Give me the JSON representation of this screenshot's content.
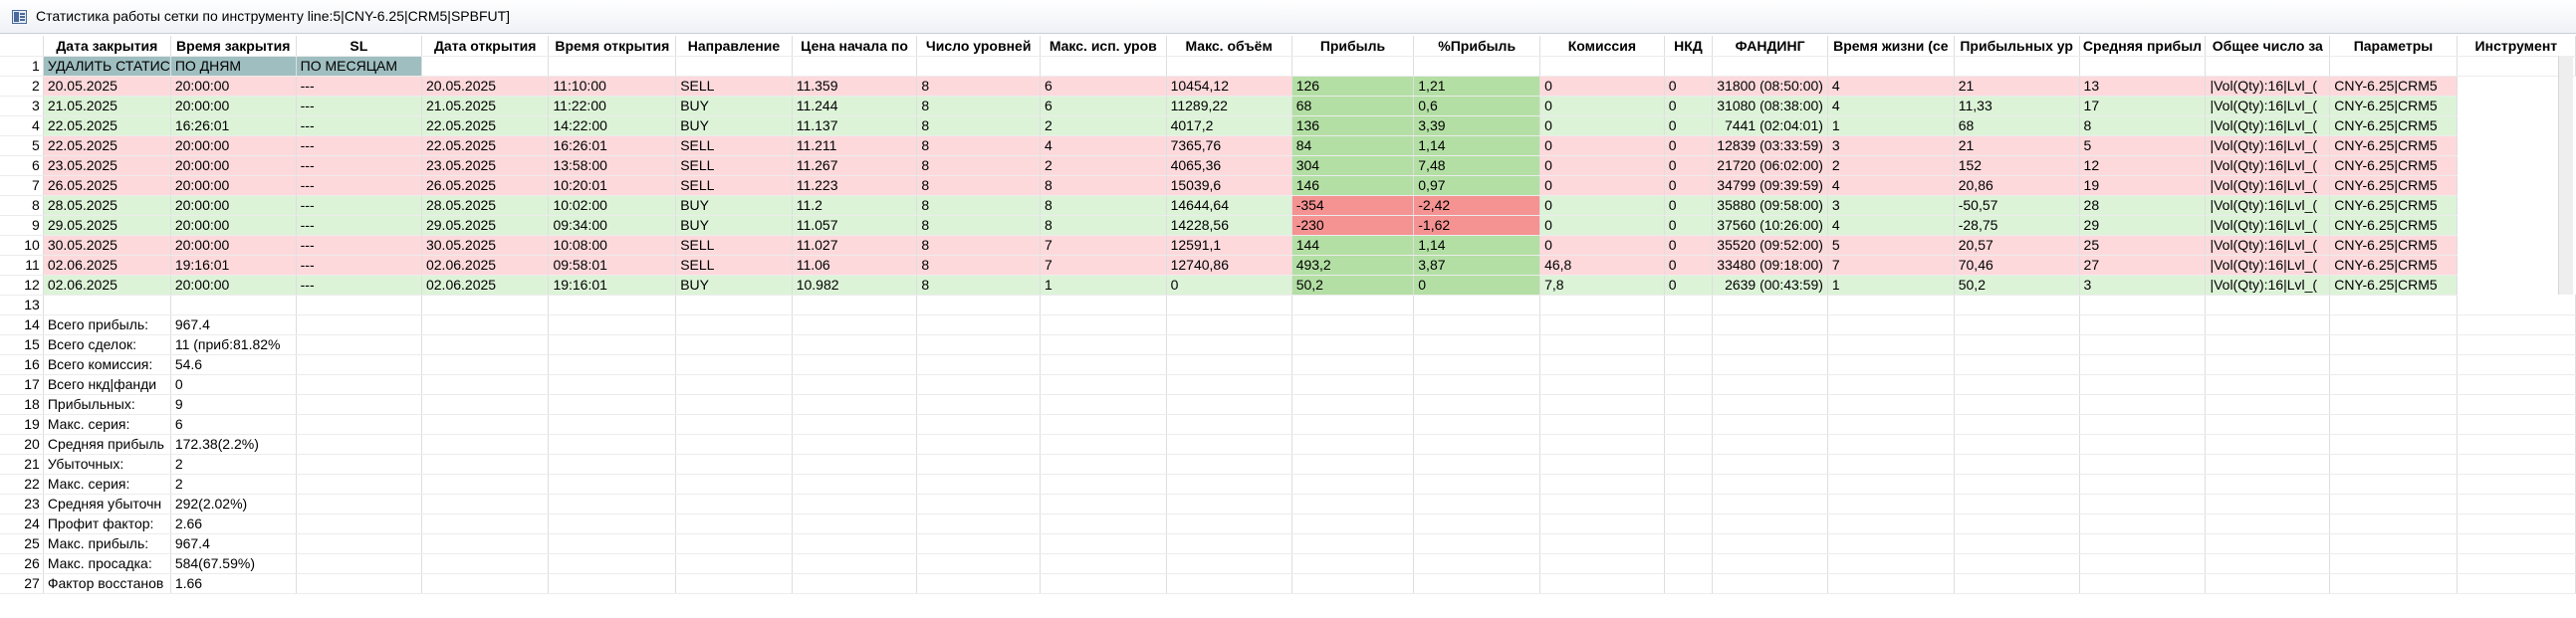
{
  "window": {
    "title": "Статистика работы сетки по инструменту line:5|CNY-6.25|CRM5|SPBFUT]"
  },
  "columns": [
    "",
    "Дата закрытия",
    "Время закрытия",
    "SL",
    "Дата открытия",
    "Время открытия",
    "Направление",
    "Цена начала по",
    "Число уровней",
    "Макс. исп. уров",
    "Макс. объём",
    "Прибыль",
    "%Прибыль",
    "Комиссия",
    "НКД",
    "ФАНДИНГ",
    "Время жизни (се",
    "Прибыльных ур",
    "Средняя прибыл",
    "Общее число за",
    "Параметры",
    "Инструмент"
  ],
  "controls": {
    "delete_stats": "УДАЛИТЬ СТАТИС",
    "by_days": "ПО ДНЯМ",
    "by_months": "ПО МЕСЯЦАМ"
  },
  "trades": [
    {
      "n": "2",
      "close_date": "20.05.2025",
      "close_time": "20:00:00",
      "sl": "---",
      "open_date": "20.05.2025",
      "open_time": "11:10:00",
      "dir": "SELL",
      "price": "11.359",
      "levels": "8",
      "max_levels": "6",
      "max_vol": "10454,12",
      "profit": "126",
      "pct": "1,21",
      "comm": "0",
      "nkd": "0",
      "lifetime": "31800 (08:50:00)",
      "profit_levels": "4",
      "avg_profit": "21",
      "total": "13",
      "params": "|Vol(Qty):16|Lvl_(",
      "instr": "CNY-6.25|CRM5"
    },
    {
      "n": "3",
      "close_date": "21.05.2025",
      "close_time": "20:00:00",
      "sl": "---",
      "open_date": "21.05.2025",
      "open_time": "11:22:00",
      "dir": "BUY",
      "price": "11.244",
      "levels": "8",
      "max_levels": "6",
      "max_vol": "11289,22",
      "profit": "68",
      "pct": "0,6",
      "comm": "0",
      "nkd": "0",
      "lifetime": "31080 (08:38:00)",
      "profit_levels": "4",
      "avg_profit": "11,33",
      "total": "17",
      "params": "|Vol(Qty):16|Lvl_(",
      "instr": "CNY-6.25|CRM5"
    },
    {
      "n": "4",
      "close_date": "22.05.2025",
      "close_time": "16:26:01",
      "sl": "---",
      "open_date": "22.05.2025",
      "open_time": "14:22:00",
      "dir": "BUY",
      "price": "11.137",
      "levels": "8",
      "max_levels": "2",
      "max_vol": "4017,2",
      "profit": "136",
      "pct": "3,39",
      "comm": "0",
      "nkd": "0",
      "lifetime": "7441 (02:04:01)",
      "profit_levels": "1",
      "avg_profit": "68",
      "total": "8",
      "params": "|Vol(Qty):16|Lvl_(",
      "instr": "CNY-6.25|CRM5"
    },
    {
      "n": "5",
      "close_date": "22.05.2025",
      "close_time": "20:00:00",
      "sl": "---",
      "open_date": "22.05.2025",
      "open_time": "16:26:01",
      "dir": "SELL",
      "price": "11.211",
      "levels": "8",
      "max_levels": "4",
      "max_vol": "7365,76",
      "profit": "84",
      "pct": "1,14",
      "comm": "0",
      "nkd": "0",
      "lifetime": "12839 (03:33:59)",
      "profit_levels": "3",
      "avg_profit": "21",
      "total": "5",
      "params": "|Vol(Qty):16|Lvl_(",
      "instr": "CNY-6.25|CRM5"
    },
    {
      "n": "6",
      "close_date": "23.05.2025",
      "close_time": "20:00:00",
      "sl": "---",
      "open_date": "23.05.2025",
      "open_time": "13:58:00",
      "dir": "SELL",
      "price": "11.267",
      "levels": "8",
      "max_levels": "2",
      "max_vol": "4065,36",
      "profit": "304",
      "pct": "7,48",
      "comm": "0",
      "nkd": "0",
      "lifetime": "21720 (06:02:00)",
      "profit_levels": "2",
      "avg_profit": "152",
      "total": "12",
      "params": "|Vol(Qty):16|Lvl_(",
      "instr": "CNY-6.25|CRM5"
    },
    {
      "n": "7",
      "close_date": "26.05.2025",
      "close_time": "20:00:00",
      "sl": "---",
      "open_date": "26.05.2025",
      "open_time": "10:20:01",
      "dir": "SELL",
      "price": "11.223",
      "levels": "8",
      "max_levels": "8",
      "max_vol": "15039,6",
      "profit": "146",
      "pct": "0,97",
      "comm": "0",
      "nkd": "0",
      "lifetime": "34799 (09:39:59)",
      "profit_levels": "4",
      "avg_profit": "20,86",
      "total": "19",
      "params": "|Vol(Qty):16|Lvl_(",
      "instr": "CNY-6.25|CRM5"
    },
    {
      "n": "8",
      "close_date": "28.05.2025",
      "close_time": "20:00:00",
      "sl": "---",
      "open_date": "28.05.2025",
      "open_time": "10:02:00",
      "dir": "BUY",
      "price": "11.2",
      "levels": "8",
      "max_levels": "8",
      "max_vol": "14644,64",
      "profit": "-354",
      "pct": "-2,42",
      "comm": "0",
      "nkd": "0",
      "lifetime": "35880 (09:58:00)",
      "profit_levels": "3",
      "avg_profit": "-50,57",
      "total": "28",
      "params": "|Vol(Qty):16|Lvl_(",
      "instr": "CNY-6.25|CRM5"
    },
    {
      "n": "9",
      "close_date": "29.05.2025",
      "close_time": "20:00:00",
      "sl": "---",
      "open_date": "29.05.2025",
      "open_time": "09:34:00",
      "dir": "BUY",
      "price": "11.057",
      "levels": "8",
      "max_levels": "8",
      "max_vol": "14228,56",
      "profit": "-230",
      "pct": "-1,62",
      "comm": "0",
      "nkd": "0",
      "lifetime": "37560 (10:26:00)",
      "profit_levels": "4",
      "avg_profit": "-28,75",
      "total": "29",
      "params": "|Vol(Qty):16|Lvl_(",
      "instr": "CNY-6.25|CRM5"
    },
    {
      "n": "10",
      "close_date": "30.05.2025",
      "close_time": "20:00:00",
      "sl": "---",
      "open_date": "30.05.2025",
      "open_time": "10:08:00",
      "dir": "SELL",
      "price": "11.027",
      "levels": "8",
      "max_levels": "7",
      "max_vol": "12591,1",
      "profit": "144",
      "pct": "1,14",
      "comm": "0",
      "nkd": "0",
      "lifetime": "35520 (09:52:00)",
      "profit_levels": "5",
      "avg_profit": "20,57",
      "total": "25",
      "params": "|Vol(Qty):16|Lvl_(",
      "instr": "CNY-6.25|CRM5"
    },
    {
      "n": "11",
      "close_date": "02.06.2025",
      "close_time": "19:16:01",
      "sl": "---",
      "open_date": "02.06.2025",
      "open_time": "09:58:01",
      "dir": "SELL",
      "price": "11.06",
      "levels": "8",
      "max_levels": "7",
      "max_vol": "12740,86",
      "profit": "493,2",
      "pct": "3,87",
      "comm": "46,8",
      "nkd": "0",
      "lifetime": "33480 (09:18:00)",
      "profit_levels": "7",
      "avg_profit": "70,46",
      "total": "27",
      "params": "|Vol(Qty):16|Lvl_(",
      "instr": "CNY-6.25|CRM5"
    },
    {
      "n": "12",
      "close_date": "02.06.2025",
      "close_time": "20:00:00",
      "sl": "---",
      "open_date": "02.06.2025",
      "open_time": "19:16:01",
      "dir": "BUY",
      "price": "10.982",
      "levels": "8",
      "max_levels": "1",
      "max_vol": "0",
      "profit": "50,2",
      "pct": "0",
      "comm": "7,8",
      "nkd": "0",
      "lifetime": "2639 (00:43:59)",
      "profit_levels": "1",
      "avg_profit": "50,2",
      "total": "3",
      "params": "|Vol(Qty):16|Lvl_(",
      "instr": "CNY-6.25|CRM5"
    }
  ],
  "empty_row_numbers": [
    "1",
    "13"
  ],
  "summary": [
    {
      "n": "14",
      "label": "Всего прибыль:",
      "value": "967.4"
    },
    {
      "n": "15",
      "label": "Всего сделок:",
      "value": "11 (приб:81.82%"
    },
    {
      "n": "16",
      "label": "Всего комиссия:",
      "value": "54.6"
    },
    {
      "n": "17",
      "label": "Всего нкд|фанди",
      "value": "0"
    },
    {
      "n": "18",
      "label": "Прибыльных:",
      "value": "9"
    },
    {
      "n": "19",
      "label": "Макс. серия:",
      "value": "6"
    },
    {
      "n": "20",
      "label": "Средняя прибыль",
      "value": "172.38(2.2%)"
    },
    {
      "n": "21",
      "label": "Убыточных:",
      "value": "2"
    },
    {
      "n": "22",
      "label": "Макс. серия:",
      "value": "2"
    },
    {
      "n": "23",
      "label": "Средняя убыточн",
      "value": "292(2.02%)"
    },
    {
      "n": "24",
      "label": "Профит фактор:",
      "value": "2.66"
    },
    {
      "n": "25",
      "label": "Макс. прибыль:",
      "value": "967.4"
    },
    {
      "n": "26",
      "label": "Макс. просадка:",
      "value": "584(67.59%)"
    },
    {
      "n": "27",
      "label": "Фактор восстанов",
      "value": "1.66"
    }
  ],
  "colors": {
    "sell_row": "#fdd9dc",
    "buy_row": "#dcf3d8",
    "profit_positive": "#b3dfa4",
    "profit_negative": "#f59292",
    "button": "#9fbec0"
  }
}
